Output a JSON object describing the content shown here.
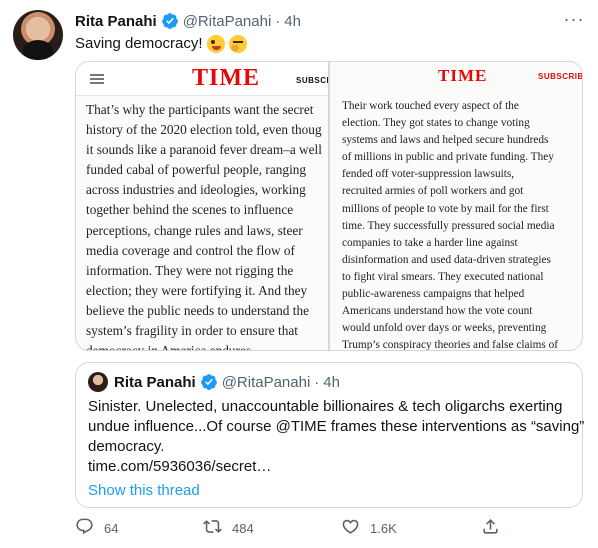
{
  "tweet": {
    "author_name": "Rita Panahi",
    "handle": "@RitaPanahi",
    "separator": "·",
    "time": "4h",
    "text": "Saving democracy!",
    "more_label": "···"
  },
  "media": {
    "left": {
      "logo": "TIME",
      "subscribe": "SUBSCRI",
      "lines": [
        "That’s why the participants want the secret",
        "history of the 2020 election told, even thoug",
        "it sounds like a paranoid fever dream–a well",
        "funded cabal of powerful people, ranging",
        "across industries and ideologies, working",
        "together behind the scenes to influence",
        "perceptions, change rules and laws, steer",
        "media coverage and control the flow of",
        "information. They were not rigging the",
        "election; they were fortifying it. And they",
        "believe the public needs to understand the",
        "system’s fragility in order to ensure that",
        "democracy in America endures."
      ]
    },
    "right": {
      "logo": "TIME",
      "subscribe": "SUBSCRIBE",
      "lines": [
        "Their work touched every aspect of the",
        "election. They got states to change voting",
        "systems and laws and helped secure hundreds",
        "of millions in public and private funding. They",
        "fended off voter-suppression lawsuits,",
        "recruited armies of poll workers and got",
        "millions of people to vote by mail for the first",
        "time. They successfully pressured social media",
        "companies to take a harder line against",
        "disinformation and used data-driven strategies",
        "to fight viral smears. They executed national",
        "public-awareness campaigns that helped",
        "Americans understand how the vote count",
        "would unfold over days or weeks, preventing",
        "Trump’s conspiracy theories and false claims of"
      ]
    }
  },
  "quote": {
    "author_name": "Rita Panahi",
    "handle": "@RitaPanahi",
    "separator": "·",
    "time": "4h",
    "lines": [
      "Sinister. Unelected, unaccountable  billionaires & tech oligarchs exerting",
      "undue influence...Of course @TIME frames these interventions as “saving”",
      "democracy.",
      "time.com/5936036/secret…"
    ],
    "show_thread": "Show this thread"
  },
  "actions": {
    "reply_count": "64",
    "retweet_count": "484",
    "like_count": "1.6K",
    "share_label": ""
  },
  "colors": {
    "accent": "#1d9bf0",
    "muted": "#536471",
    "time_red": "#e90606"
  },
  "icons": [
    "verified-badge-icon",
    "more-icon",
    "reply-icon",
    "retweet-icon",
    "like-icon",
    "share-icon"
  ]
}
